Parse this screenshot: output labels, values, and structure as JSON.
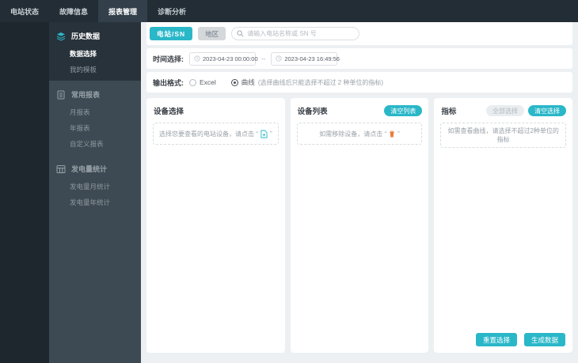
{
  "topnav": {
    "items": [
      {
        "label": "电站状态",
        "active": false
      },
      {
        "label": "故障信息",
        "active": false
      },
      {
        "label": "报表管理",
        "active": true
      },
      {
        "label": "诊断分析",
        "active": false
      }
    ]
  },
  "sidebar": {
    "groups": [
      {
        "label": "历史数据",
        "icon": "layers-icon",
        "active": true,
        "items": [
          {
            "label": "数据选择",
            "active": true
          },
          {
            "label": "我的模板",
            "active": false
          }
        ]
      },
      {
        "label": "常用报表",
        "icon": "report-icon",
        "active": false,
        "items": [
          {
            "label": "月报表",
            "active": false
          },
          {
            "label": "年报表",
            "active": false
          },
          {
            "label": "自定义报表",
            "active": false
          }
        ]
      },
      {
        "label": "发电量统计",
        "icon": "stats-grid-icon",
        "active": false,
        "items": [
          {
            "label": "发电量月统计",
            "active": false
          },
          {
            "label": "发电量年统计",
            "active": false
          }
        ]
      }
    ]
  },
  "filters": {
    "station_btn": "电站/SN",
    "region_btn": "地区",
    "search_icon": "search-icon",
    "search_placeholder": "请输入电站名称或 SN 号",
    "time_label": "时间选择:",
    "time_start": "2023-04-23 00:00:00",
    "time_sep": "--",
    "time_end": "2023-04-23 16:49:56",
    "clock_icon": "clock-icon",
    "format_label": "输出格式:",
    "format_excel": "Excel",
    "format_curve": "曲线",
    "format_curve_note": "(选择曲线后只能选择不超过 2 种单位的指标)",
    "format_selected": "曲线"
  },
  "panels": {
    "device_select": {
      "title": "设备选择",
      "hint_prefix": "选择您要查看的电站设备，请点击 “",
      "hint_icon": "add-file-icon",
      "hint_suffix": "”"
    },
    "device_list": {
      "title": "设备列表",
      "clear_btn": "清空列表",
      "hint_prefix": "如需移除设备，请点击 “",
      "hint_icon": "trash-icon",
      "hint_suffix": "”"
    },
    "indicators": {
      "title": "指标",
      "select_all_btn": "全部选择",
      "clear_btn": "清空选择",
      "hint": "如需查看曲线，请选择不超过2种单位的指标"
    }
  },
  "actions": {
    "reset": "重置选择",
    "generate": "生成数据"
  },
  "colors": {
    "accent": "#2ab7c8",
    "warning_orange": "#e87d3c",
    "topnav_bg": "#222d35",
    "sidebar_bg": "#3e4a53",
    "sidebar_active_bg": "#28323a",
    "main_bg": "#edf0f2"
  }
}
